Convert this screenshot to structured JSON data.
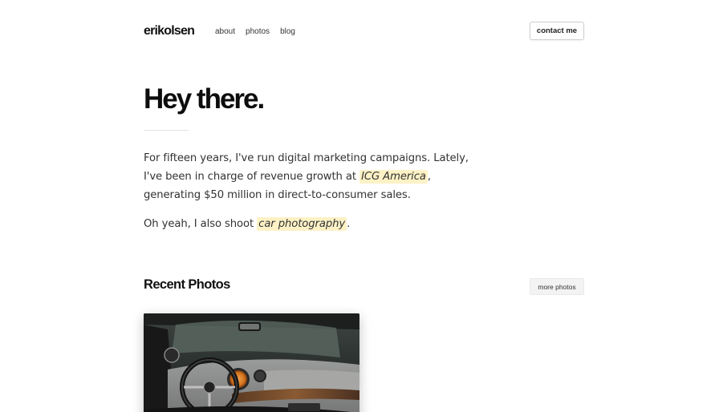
{
  "header": {
    "logo": "erikolsen",
    "nav": [
      "about",
      "photos",
      "blog"
    ],
    "contact_label": "contact me"
  },
  "hero": {
    "title": "Hey there.",
    "bio_line1": "For fifteen years, I've run digital marketing campaigns. Lately,",
    "bio_line2_pre": "I've been in charge of revenue growth at ",
    "bio_company": "ICG America",
    "bio_line2_post": ",",
    "bio_line3": "generating $50 million in direct-to-consumer sales.",
    "photo_pre": "Oh yeah, I also shoot ",
    "photo_link": "car photography",
    "photo_post": "."
  },
  "recent": {
    "title": "Recent Photos",
    "more_label": "more photos"
  },
  "colors": {
    "highlight": "#fdf1c6",
    "text": "#333333",
    "heading": "#0d0d0d"
  }
}
